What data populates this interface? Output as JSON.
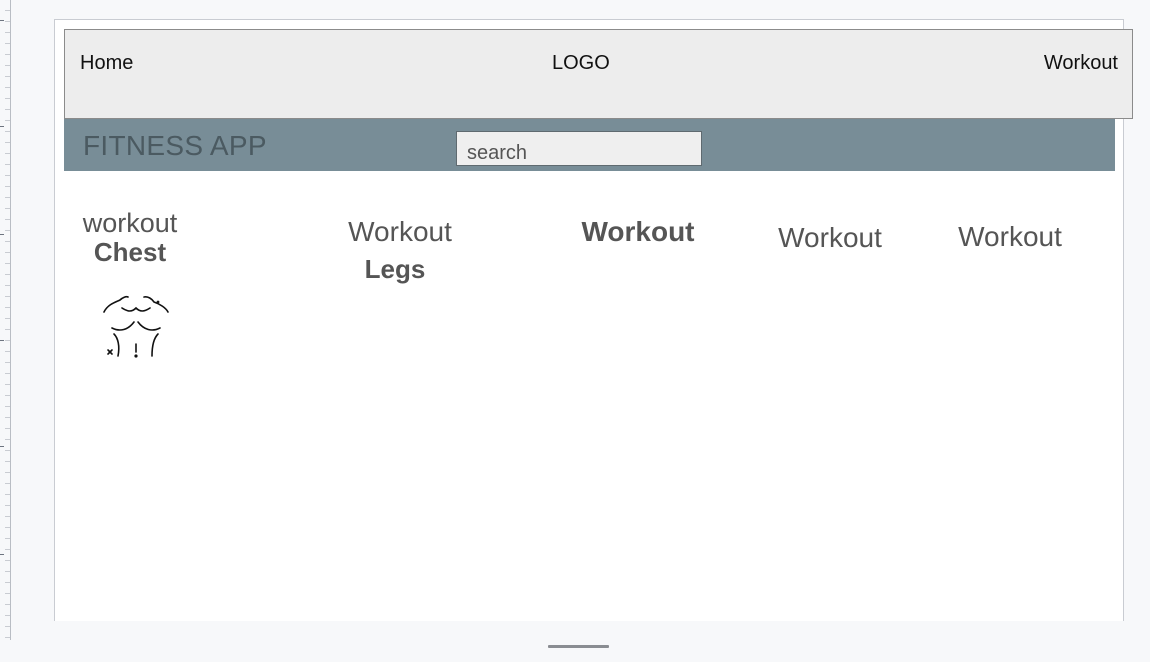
{
  "nav": {
    "home": "Home",
    "logo": "LOGO",
    "workout": "Workout"
  },
  "brand": {
    "title": "FITNESS APP"
  },
  "search": {
    "placeholder": "search"
  },
  "cards": [
    {
      "title": "workout",
      "subtitle": "Chest",
      "icon": "chest-muscle-icon"
    },
    {
      "title": "Workout",
      "subtitle": "Legs"
    },
    {
      "title": "Workout"
    },
    {
      "title": "Workout"
    },
    {
      "title": "Workout"
    }
  ]
}
